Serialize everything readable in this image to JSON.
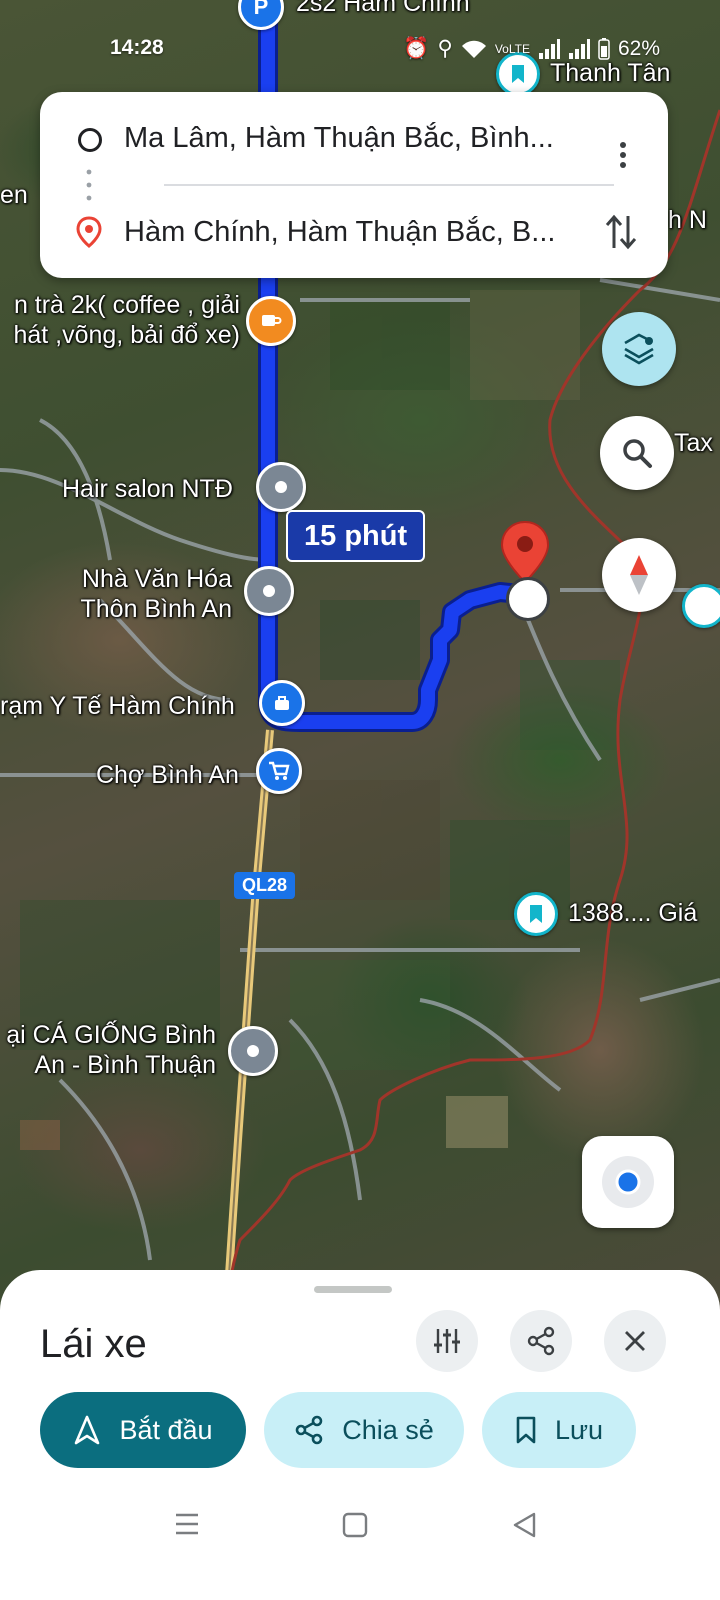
{
  "status": {
    "time": "14:28",
    "battery": "62%",
    "network": "VoLTE"
  },
  "route": {
    "origin": "Ma Lâm, Hàm Thuận Bắc, Bình...",
    "destination": "Hàm Chính, Hàm Thuận Bắc, B..."
  },
  "map": {
    "duration": "15 phút",
    "road_shield": "QL28",
    "labels": {
      "top_parking": "2s2 Hàm Chính",
      "thanh_tan": "Thanh Tân",
      "left_edge": "en",
      "right_edge_1": "h N",
      "coffee": "n trà 2k( coffee , giải\nhát ,võng, bải đổ xe)",
      "hair_salon": "Hair salon NTĐ",
      "nha_van_hoa": "Nhà Văn Hóa\nThôn Bình An",
      "tram_y_te": "rạm Y Tế Hàm Chính",
      "cho": "Chợ Bình An",
      "saved_1388": "1388.... Giá",
      "ca_giong": "ại CÁ GIỐNG Bình\nAn - Bình Thuận",
      "tax": "Tax"
    },
    "colors": {
      "route": "#1a3ff0",
      "destination_pin": "#ea4335",
      "boundary": "#a0352a"
    }
  },
  "sheet": {
    "title": "Lái xe",
    "start_label": "Bắt đầu",
    "share_label": "Chia sẻ",
    "save_label": "Lưu"
  }
}
